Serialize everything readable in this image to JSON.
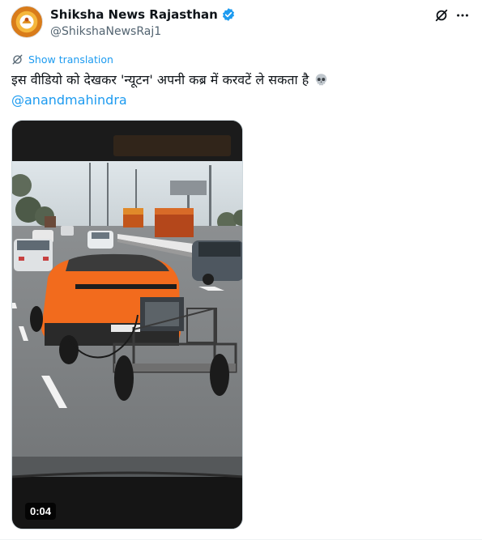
{
  "author": {
    "display_name": "Shiksha News Rajasthan",
    "handle": "@ShikshaNewsRaj1",
    "verified": true
  },
  "translate": {
    "label": "Show translation"
  },
  "tweet": {
    "text": "इस वीडियो को देखकर 'न्यूटन' अपनी कब्र में करवटें ले सकता है",
    "emoji": "skull-icon",
    "mention": "@anandmahindra"
  },
  "media": {
    "type": "video",
    "duration": "0:04"
  },
  "colors": {
    "accent": "#1d9bf0",
    "car": "#f26b1d",
    "verified": "#1d9bf0"
  }
}
